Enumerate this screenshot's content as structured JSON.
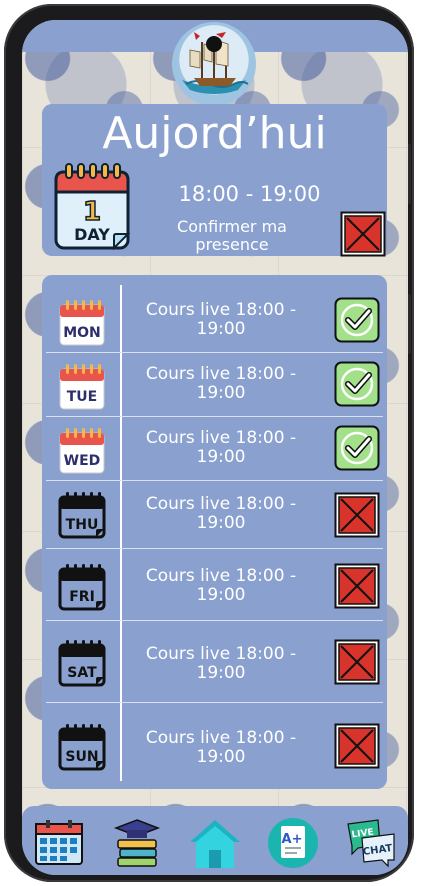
{
  "header": {
    "logo": "sailing-ship-logo"
  },
  "today": {
    "title": "Aujord’hui",
    "calendar_icon": "calendar-1-day-icon",
    "calendar_number": "1",
    "calendar_word": "DAY",
    "time": "18:00 - 19:00",
    "confirm_label": "Confirmer ma presence",
    "confirm_status": "unconfirmed"
  },
  "schedule": [
    {
      "day": "MON",
      "line1": "Cours live 18:00 -",
      "line2": "19:00",
      "status": "confirmed",
      "icon_style": "color",
      "accent": "#e25b5b"
    },
    {
      "day": "TUE",
      "line1": "Cours live 18:00 -",
      "line2": "19:00",
      "status": "confirmed",
      "icon_style": "color",
      "accent": "#e25b5b"
    },
    {
      "day": "WED",
      "line1": "Cours live 18:00 -",
      "line2": "19:00",
      "status": "confirmed",
      "icon_style": "color",
      "accent": "#e25b5b"
    },
    {
      "day": "THU",
      "line1": "Cours live 18:00 -",
      "line2": "19:00",
      "status": "unconfirmed",
      "icon_style": "mono"
    },
    {
      "day": "FRI",
      "line1": "Cours live 18:00 -",
      "line2": "19:00",
      "status": "unconfirmed",
      "icon_style": "mono"
    },
    {
      "day": "SAT",
      "line1": "Cours live 18:00 -",
      "line2": "19:00",
      "status": "unconfirmed",
      "icon_style": "mono"
    },
    {
      "day": "SUN",
      "line1": "Cours live 18:00 -",
      "line2": "19:00",
      "status": "unconfirmed",
      "icon_style": "mono"
    }
  ],
  "tabbar": {
    "calendar": "calendar-grid-icon",
    "courses": "books-graduation-icon",
    "home": "home-icon",
    "grades": "grade-document-icon",
    "chat": "live-chat-icon",
    "chat_top": "LIVE",
    "chat_bottom": "CHAT",
    "grade_mark": "A+"
  },
  "colors": {
    "panel": "#8aa0cf",
    "check_fill": "#a3e08a",
    "cross_fill": "#d9342b",
    "home_fill": "#33d3df"
  }
}
